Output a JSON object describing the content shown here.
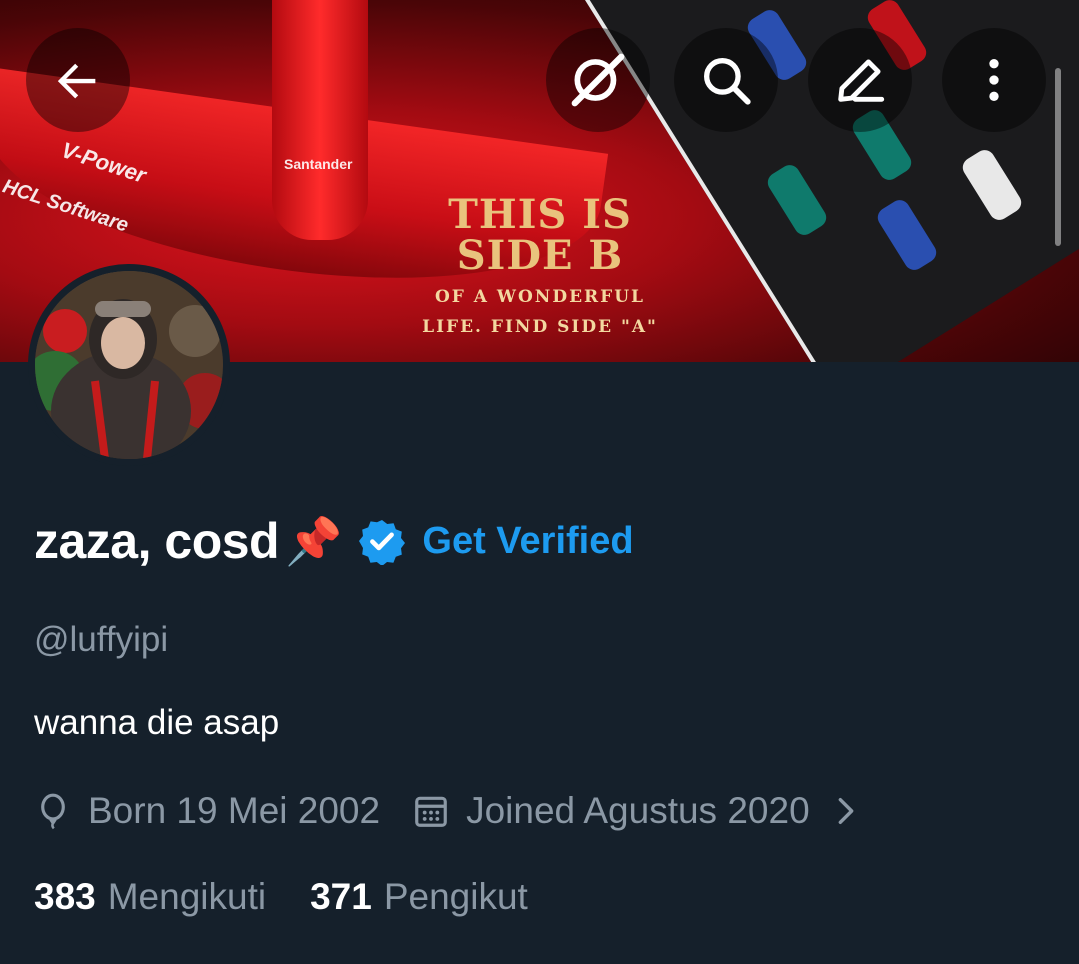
{
  "header": {
    "back_icon": "arrow-left-icon",
    "grok_icon": "grok-icon",
    "search_icon": "search-icon",
    "edit_icon": "pencil-icon",
    "more_icon": "more-vertical-icon"
  },
  "banner": {
    "sponsor_1": "V-Power",
    "sponsor_2": "HCL Software",
    "sponsor_3": "Santander",
    "poster_line_1": "THIS IS",
    "poster_line_2": "SIDE B",
    "poster_line_3": "OF A WONDERFUL",
    "poster_line_4": "LIFE. FIND SIDE \"A\""
  },
  "profile": {
    "display_name": "zaza, cosd",
    "name_emoji": "📌",
    "verified_badge_color": "#1d9bf0",
    "get_verified_label": "Get Verified",
    "handle": "@luffyipi",
    "bio": "wanna die asap",
    "birth_label": "Born 19 Mei 2002",
    "joined_label": "Joined Agustus 2020",
    "following_count": "383",
    "following_label": "Mengikuti",
    "followers_count": "371",
    "followers_label": "Pengikut"
  },
  "colors": {
    "background": "#15202b",
    "accent": "#1d9bf0",
    "secondary_text": "#8b98a5"
  }
}
